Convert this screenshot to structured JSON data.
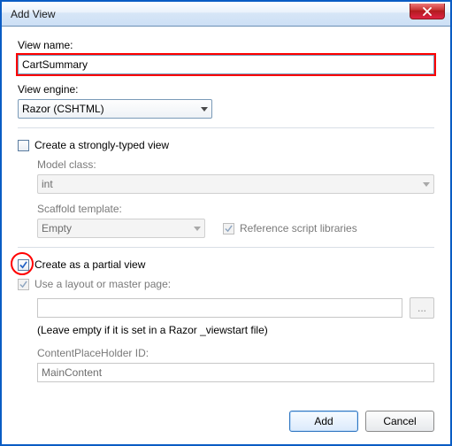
{
  "window": {
    "title": "Add View"
  },
  "viewName": {
    "label": "View name:",
    "value": "CartSummary"
  },
  "viewEngine": {
    "label": "View engine:",
    "value": "Razor (CSHTML)"
  },
  "stronglyTyped": {
    "label": "Create a strongly-typed view",
    "checked": false,
    "modelClass": {
      "label": "Model class:",
      "value": "int"
    },
    "scaffold": {
      "label": "Scaffold template:",
      "value": "Empty"
    },
    "referenceScripts": {
      "label": "Reference script libraries",
      "checked": true
    }
  },
  "partialView": {
    "label": "Create as a partial view",
    "checked": true
  },
  "layout": {
    "useLabel": "Use a layout or master page:",
    "checked": true,
    "path": "",
    "hint": "(Leave empty if it is set in a Razor _viewstart file)",
    "placeholderIdLabel": "ContentPlaceHolder ID:",
    "placeholderIdValue": "MainContent",
    "browse": "..."
  },
  "buttons": {
    "add": "Add",
    "cancel": "Cancel"
  }
}
